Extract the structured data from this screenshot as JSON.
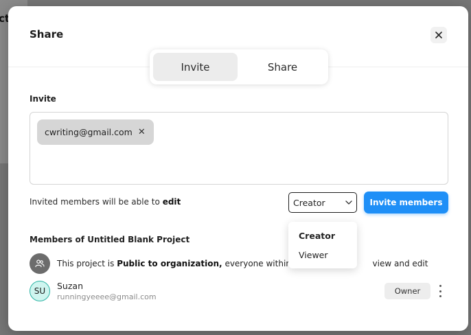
{
  "background": {
    "partial_text": "ct"
  },
  "modal": {
    "title": "Share",
    "close_icon": "close-icon",
    "tabs": [
      {
        "label": "Invite",
        "active": true
      },
      {
        "label": "Share",
        "active": false
      }
    ]
  },
  "invite": {
    "section_label": "Invite",
    "chips": [
      {
        "email": "cwriting@gmail.com",
        "remove_glyph": "✕"
      }
    ],
    "edit_note_prefix": "Invited members will be able to",
    "edit_note_permission": "edit",
    "role_select": {
      "value": "Creator",
      "options": [
        "Creator",
        "Viewer"
      ]
    },
    "invite_button": "Invite members",
    "accent_color": "#1e8ff7"
  },
  "members": {
    "title": "Members of Untitled Blank Project",
    "public_notice": {
      "prefix": "This project is",
      "emphasis": "Public to organization,",
      "left_part": "everyone within the o",
      "right_part": "view and edit"
    },
    "list": [
      {
        "initials": "SU",
        "name": "Suzan",
        "email": "runningyeeee@gmail.com",
        "role": "Owner"
      }
    ]
  }
}
